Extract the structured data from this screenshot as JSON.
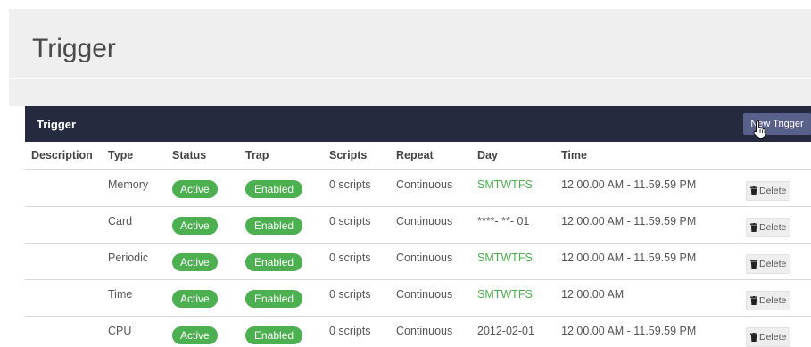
{
  "page": {
    "title": "Trigger"
  },
  "panel": {
    "title": "Trigger",
    "new_button": "New Trigger"
  },
  "columns": [
    "Description",
    "Type",
    "Status",
    "Trap",
    "Scripts",
    "Repeat",
    "Day",
    "Time"
  ],
  "rows": [
    {
      "description": "",
      "type": "Memory",
      "status": "Active",
      "trap": "Enabled",
      "scripts": "0 scripts",
      "repeat": "Continuous",
      "day": "SMTWTFS",
      "day_green": true,
      "time": "12.00.00 AM - 11.59.59 PM",
      "delete": "Delete"
    },
    {
      "description": "",
      "type": "Card",
      "status": "Active",
      "trap": "Enabled",
      "scripts": "0 scripts",
      "repeat": "Continuous",
      "day": "****- **- 01",
      "day_green": false,
      "time": "12.00.00 AM - 11.59.59 PM",
      "delete": "Delete"
    },
    {
      "description": "",
      "type": "Periodic",
      "status": "Active",
      "trap": "Enabled",
      "scripts": "0 scripts",
      "repeat": "Continuous",
      "day": "SMTWTFS",
      "day_green": true,
      "time": "12.00.00 AM - 11.59.59 PM",
      "delete": "Delete"
    },
    {
      "description": "",
      "type": "Time",
      "status": "Active",
      "trap": "Enabled",
      "scripts": "0 scripts",
      "repeat": "Continuous",
      "day": "SMTWTFS",
      "day_green": true,
      "time": "12.00.00 AM",
      "delete": "Delete"
    },
    {
      "description": "",
      "type": "CPU",
      "status": "Active",
      "trap": "Enabled",
      "scripts": "0 scripts",
      "repeat": "Continuous",
      "day": "2012-02-01",
      "day_green": false,
      "time": "12.00.00 AM - 11.59.59 PM",
      "delete": "Delete"
    }
  ],
  "colors": {
    "header_bg": "#252a3e",
    "button_bg": "#59608a",
    "badge_green": "#4caf50",
    "page_bg": "#efefef"
  },
  "icons": {
    "delete": "trash-icon",
    "cursor": "hand-pointer-icon"
  }
}
